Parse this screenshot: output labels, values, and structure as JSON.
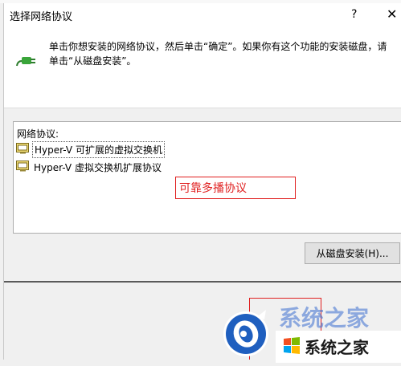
{
  "window": {
    "title": "选择网络协议",
    "help_label": "?",
    "close_label": "✕"
  },
  "header": {
    "description": "单击你想安装的网络协议，然后单击“确定”。如果你有这个功能的安装磁盘，请单击“从磁盘安装”。",
    "icon": "network-protocol-plug-icon"
  },
  "protocol_list": {
    "header": "网络协议:",
    "items": [
      {
        "label": "Hyper-V 可扩展的虚拟交换机",
        "icon": "protocol-item-icon"
      },
      {
        "label": "Hyper-V 虚拟交换机扩展协议",
        "icon": "protocol-item-icon"
      }
    ]
  },
  "annotation": {
    "text": "可靠多播协议",
    "color": "#e02020"
  },
  "buttons": {
    "install_from_disk": "从磁盘安装(H)..."
  },
  "watermark": {
    "text": "系统之家",
    "partial_text": "系统之家"
  },
  "colors": {
    "annotation_red": "#e02020",
    "dialog_bg": "#f0f0f0",
    "button_bg": "#e1e1e1",
    "plug_green": "#3aa53a"
  }
}
